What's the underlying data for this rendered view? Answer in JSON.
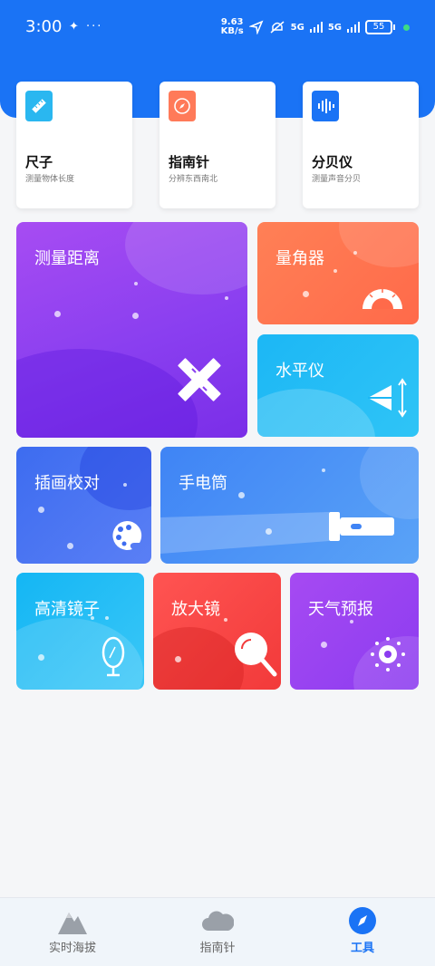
{
  "status_bar": {
    "time": "3:00",
    "left_icons": "✦ ···",
    "speed": "9.63\nKB/s",
    "net1": "5G",
    "net2": "5G",
    "battery": "55"
  },
  "tools": [
    {
      "name": "尺子",
      "desc": "测量物体长度",
      "icon": "ruler-icon",
      "color": "#2ab7f0"
    },
    {
      "name": "指南针",
      "desc": "分辨东西南北",
      "icon": "compass-icon",
      "color": "#ff7a59"
    },
    {
      "name": "分贝仪",
      "desc": "测量声音分贝",
      "icon": "decibel-icon",
      "color": "#1a73f5"
    }
  ],
  "tiles": {
    "measure_distance": "测量距离",
    "protractor": "量角器",
    "level": "水平仪",
    "illustration_proof": "插画校对",
    "flashlight": "手电筒",
    "mirror": "高清镜子",
    "magnifier": "放大镜",
    "weather": "天气预报"
  },
  "nav": [
    {
      "label": "实时海拔",
      "icon": "mountain-icon",
      "active": false
    },
    {
      "label": "指南针",
      "icon": "cloud-icon",
      "active": false
    },
    {
      "label": "工具",
      "icon": "compass-icon",
      "active": true
    }
  ],
  "colors": {
    "brand": "#1a73f5"
  }
}
